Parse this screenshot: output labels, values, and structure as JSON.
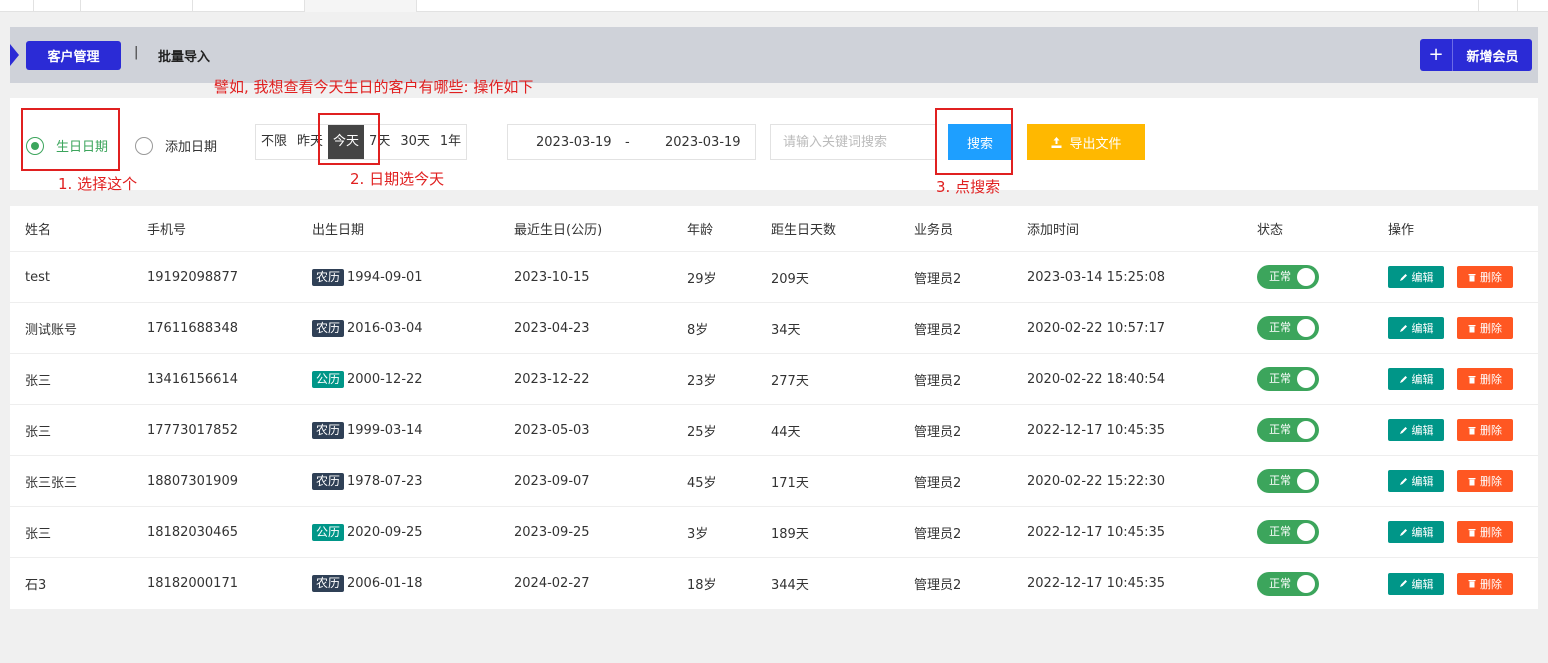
{
  "tabs": {
    "active": "客户管理",
    "separator": "|",
    "import": "批量导入"
  },
  "add_button": {
    "icon": "+",
    "label": "新增会员"
  },
  "annotations": {
    "example": "譬如, 我想查看今天生日的客户有哪些: 操作如下",
    "step1": "1. 选择这个",
    "step2": "2. 日期选今天",
    "step3": "3. 点搜索"
  },
  "filter": {
    "radio_birthday": "生日日期",
    "radio_added": "添加日期",
    "quick_dates": [
      "不限",
      "昨天",
      "今天",
      "7天",
      "30天",
      "1年"
    ],
    "date_start": "2023-03-19",
    "date_dash": "-",
    "date_end": "2023-03-19",
    "keyword_placeholder": "请输入关键词搜索",
    "search_label": "搜索",
    "export_label": "导出文件"
  },
  "table": {
    "headers": [
      "姓名",
      "手机号",
      "出生日期",
      "最近生日(公历)",
      "年龄",
      "距生日天数",
      "业务员",
      "添加时间",
      "状态",
      "操作"
    ],
    "rows": [
      {
        "name": "test",
        "phone": "19192098877",
        "cal": "农历",
        "birth": "1994-09-01",
        "next": "2023-10-15",
        "age": "29岁",
        "days": "209天",
        "agent": "管理员2",
        "added": "2023-03-14 15:25:08"
      },
      {
        "name": "测试账号",
        "phone": "17611688348",
        "cal": "农历",
        "birth": "2016-03-04",
        "next": "2023-04-23",
        "age": "8岁",
        "days": "34天",
        "agent": "管理员2",
        "added": "2020-02-22 10:57:17"
      },
      {
        "name": "张三",
        "phone": "13416156614",
        "cal": "公历",
        "birth": "2000-12-22",
        "next": "2023-12-22",
        "age": "23岁",
        "days": "277天",
        "agent": "管理员2",
        "added": "2020-02-22 18:40:54"
      },
      {
        "name": "张三",
        "phone": "17773017852",
        "cal": "农历",
        "birth": "1999-03-14",
        "next": "2023-05-03",
        "age": "25岁",
        "days": "44天",
        "agent": "管理员2",
        "added": "2022-12-17 10:45:35"
      },
      {
        "name": "张三张三",
        "phone": "18807301909",
        "cal": "农历",
        "birth": "1978-07-23",
        "next": "2023-09-07",
        "age": "45岁",
        "days": "171天",
        "agent": "管理员2",
        "added": "2020-02-22 15:22:30"
      },
      {
        "name": "张三",
        "phone": "18182030465",
        "cal": "公历",
        "birth": "2020-09-25",
        "next": "2023-09-25",
        "age": "3岁",
        "days": "189天",
        "agent": "管理员2",
        "added": "2022-12-17 10:45:35"
      },
      {
        "name": "石3",
        "phone": "18182000171",
        "cal": "农历",
        "birth": "2006-01-18",
        "next": "2024-02-27",
        "age": "18岁",
        "days": "344天",
        "agent": "管理员2",
        "added": "2022-12-17 10:45:35"
      }
    ],
    "status_label": "正常",
    "edit_label": "编辑",
    "delete_label": "删除"
  },
  "colors": {
    "primary": "#2b2bd6",
    "success": "#3ca55c",
    "search": "#1e9fff",
    "export": "#ffb800",
    "edit": "#009688",
    "delete": "#ff5722",
    "annotation": "#e02020"
  }
}
